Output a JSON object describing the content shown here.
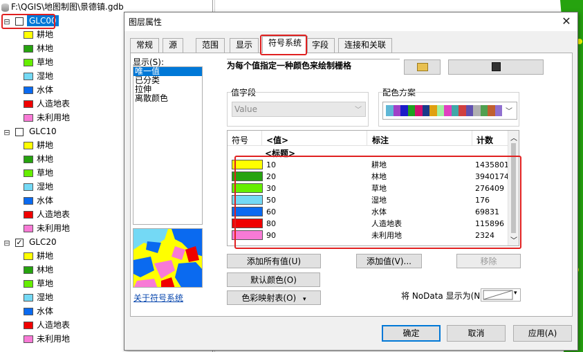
{
  "toc": {
    "path": "F:\\QGIS\\地图制图\\景德镇.gdb",
    "layers": [
      {
        "name": "GLC00",
        "checked": false,
        "selected": true,
        "expander": "⊟"
      },
      {
        "name": "GLC10",
        "checked": false,
        "selected": false,
        "expander": "⊟"
      },
      {
        "name": "GLC20",
        "checked": true,
        "selected": false,
        "expander": "⊟"
      }
    ],
    "classes": [
      {
        "label": "耕地",
        "color": "#ffff00"
      },
      {
        "label": "林地",
        "color": "#26a30f"
      },
      {
        "label": "草地",
        "color": "#66ee00"
      },
      {
        "label": "湿地",
        "color": "#74d9f5"
      },
      {
        "label": "水体",
        "color": "#0a6af0"
      },
      {
        "label": "人造地表",
        "color": "#f00000"
      },
      {
        "label": "未利用地",
        "color": "#f87ad6"
      }
    ]
  },
  "dialog": {
    "title": "图层属性",
    "close": "✕",
    "tabs": [
      "常规",
      "源",
      "范围",
      "显示",
      "符号系统",
      "字段",
      "连接和关联"
    ],
    "active_tab": "符号系统",
    "show_label": "显示(S):",
    "show_options": [
      "唯一值",
      "已分类",
      "拉伸",
      "离散颜色"
    ],
    "show_selected": "唯一值",
    "about_link": "关于符号系统",
    "heading": "为每个值指定一种颜色来绘制栅格",
    "value_field_label": "值字段",
    "value_field_value": "Value",
    "color_scheme_label": "配色方案",
    "color_scheme_colors": [
      "#5fb7d6",
      "#a040c8",
      "#1c1cc8",
      "#20a020",
      "#d01070",
      "#1a3a8a",
      "#e0a010",
      "#a0f0a0",
      "#e040c0",
      "#40a8a8",
      "#d04040",
      "#6050b0",
      "#b0b0b0",
      "#50a050",
      "#c06030",
      "#9070d0"
    ],
    "table": {
      "headers": [
        "符号",
        "<值>",
        "标注",
        "计数"
      ],
      "heading_row": "<标题>",
      "rows": [
        {
          "color": "#ffff00",
          "value": "10",
          "label": "耕地",
          "count": "1435801"
        },
        {
          "color": "#26a30f",
          "value": "20",
          "label": "林地",
          "count": "3940174"
        },
        {
          "color": "#66ee00",
          "value": "30",
          "label": "草地",
          "count": "276409"
        },
        {
          "color": "#74d9f5",
          "value": "50",
          "label": "湿地",
          "count": "176"
        },
        {
          "color": "#0a6af0",
          "value": "60",
          "label": "水体",
          "count": "69831"
        },
        {
          "color": "#f00000",
          "value": "80",
          "label": "人造地表",
          "count": "115896"
        },
        {
          "color": "#f87ad6",
          "value": "90",
          "label": "未利用地",
          "count": "2324"
        }
      ]
    },
    "buttons": {
      "add_all": "添加所有值(U)",
      "add_values": "添加值(V)...",
      "remove": "移除",
      "default_colors": "默认颜色(O)",
      "colormap": "色彩映射表(O)",
      "ok": "确定",
      "cancel": "取消",
      "apply": "应用(A)"
    },
    "nodata_label": "将 NoData 显示为(N)",
    "accent_color": "#e02020"
  }
}
